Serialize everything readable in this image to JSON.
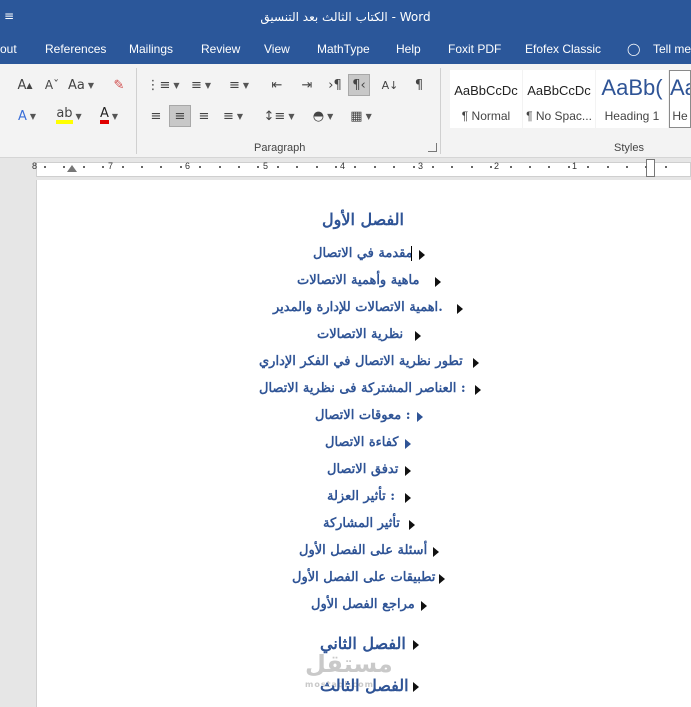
{
  "titlebar": {
    "qat_icon": "customize-qat-icon",
    "title": "الكتاب الثالث بعد التنسيق  -  Word"
  },
  "tabs": [
    "out",
    "References",
    "Mailings",
    "Review",
    "View",
    "MathType",
    "Help",
    "Foxit PDF",
    "Efofex Classic",
    "Tell me"
  ],
  "tell_me_icon": "lightbulb-icon",
  "ribbon": {
    "font_buttons": {
      "grow": "A",
      "case": "Aa",
      "effects": "A",
      "font_color": "A"
    },
    "paragraph_label": "Paragraph",
    "styles_label": "Styles",
    "styles": [
      {
        "preview": "AaBbCcDc",
        "name": "¶ Normal"
      },
      {
        "preview": "AaBbCcDc",
        "name": "¶ No Spac..."
      },
      {
        "preview": "AaBb(",
        "name": "Heading 1"
      },
      {
        "preview": "Aa",
        "name": "He"
      }
    ],
    "colors": {
      "highlight": "#ffff00",
      "font_color": "#e00000"
    }
  },
  "ruler": {
    "numbers": [
      "8",
      "7",
      "6",
      "5",
      "4",
      "3",
      "2",
      "1"
    ]
  },
  "document": {
    "heading1": "الفصل الأول",
    "items": [
      "مقدمة في الاتصال",
      "ماهية وأهمية الاتصالات",
      "اهمية الاتصالات للإدارة والمدير.",
      "نظرية الاتصالات",
      "تطور نظرية الاتصال في الفكر الإداري",
      "العناصر المشتركة فى نظرية الاتصال :",
      "معوقات الاتصال :",
      "كفاءة الاتصال",
      "تدفق الاتصال",
      "تأثير العزلة :",
      "تأثير المشاركة",
      "أسئلة على الفصل الأول",
      "تطبيقات على الفصل الأول",
      "مراجع الفصل الأول"
    ],
    "heading2": "الفصل الثاني",
    "heading3": "الفصل الثالث"
  },
  "watermark": {
    "arabic": "مستقل",
    "latin": "mostaql.com"
  }
}
